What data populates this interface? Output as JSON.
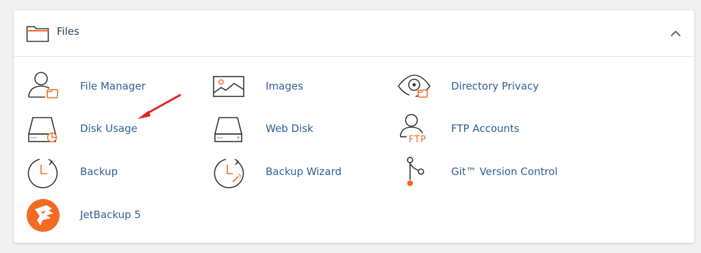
{
  "section": {
    "title": "Files",
    "collapse_icon": "chevron-up-icon"
  },
  "items": [
    {
      "label": "File Manager",
      "icon": "file-manager-icon"
    },
    {
      "label": "Images",
      "icon": "image-icon"
    },
    {
      "label": "Directory Privacy",
      "icon": "eye-icon"
    },
    {
      "label": "Disk Usage",
      "icon": "disk-usage-icon"
    },
    {
      "label": "Web Disk",
      "icon": "hard-drive-icon"
    },
    {
      "label": "FTP Accounts",
      "icon": "ftp-user-icon"
    },
    {
      "label": "Backup",
      "icon": "backup-clock-icon"
    },
    {
      "label": "Backup Wizard",
      "icon": "backup-wizard-icon"
    },
    {
      "label": "Git™ Version Control",
      "icon": "git-branch-icon"
    },
    {
      "label": "JetBackup 5",
      "icon": "jetbackup-logo-icon"
    }
  ],
  "colors": {
    "accent": "#f26b21",
    "link": "#2f5e94",
    "icon_stroke": "#333333",
    "annotation_arrow": "#e02020"
  }
}
